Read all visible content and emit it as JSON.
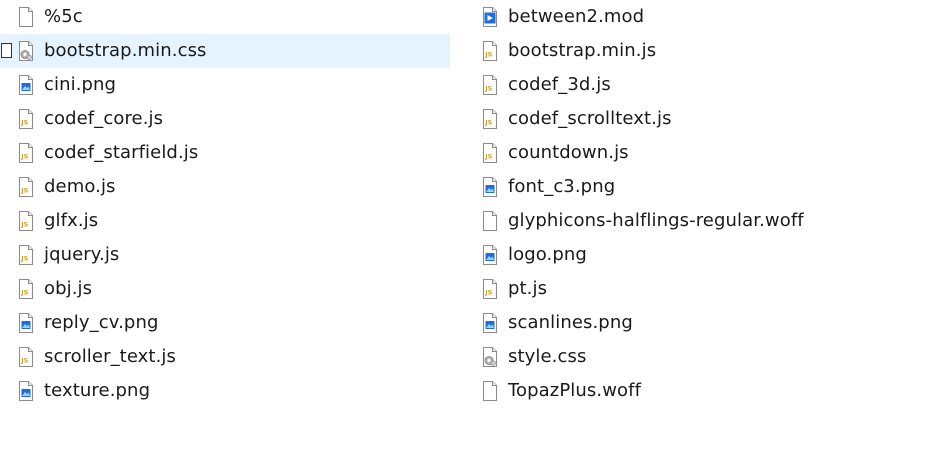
{
  "files_left": [
    {
      "name": "%5c",
      "icon": "generic-file-icon",
      "selected": false
    },
    {
      "name": "bootstrap.min.css",
      "icon": "css-file-icon",
      "selected": true
    },
    {
      "name": "cini.png",
      "icon": "image-file-icon",
      "selected": false
    },
    {
      "name": "codef_core.js",
      "icon": "js-file-icon",
      "selected": false
    },
    {
      "name": "codef_starfield.js",
      "icon": "js-file-icon",
      "selected": false
    },
    {
      "name": "demo.js",
      "icon": "js-file-icon",
      "selected": false
    },
    {
      "name": "glfx.js",
      "icon": "js-file-icon",
      "selected": false
    },
    {
      "name": "jquery.js",
      "icon": "js-file-icon",
      "selected": false
    },
    {
      "name": "obj.js",
      "icon": "js-file-icon",
      "selected": false
    },
    {
      "name": "reply_cv.png",
      "icon": "image-file-icon",
      "selected": false
    },
    {
      "name": "scroller_text.js",
      "icon": "js-file-icon",
      "selected": false
    },
    {
      "name": "texture.png",
      "icon": "image-file-icon",
      "selected": false
    }
  ],
  "files_right": [
    {
      "name": "between2.mod",
      "icon": "media-file-icon",
      "selected": false
    },
    {
      "name": "bootstrap.min.js",
      "icon": "js-file-icon",
      "selected": false
    },
    {
      "name": "codef_3d.js",
      "icon": "js-file-icon",
      "selected": false
    },
    {
      "name": "codef_scrolltext.js",
      "icon": "js-file-icon",
      "selected": false
    },
    {
      "name": "countdown.js",
      "icon": "js-file-icon",
      "selected": false
    },
    {
      "name": "font_c3.png",
      "icon": "image-file-icon",
      "selected": false
    },
    {
      "name": "glyphicons-halflings-regular.woff",
      "icon": "generic-file-icon",
      "selected": false
    },
    {
      "name": "logo.png",
      "icon": "image-file-icon",
      "selected": false
    },
    {
      "name": "pt.js",
      "icon": "js-file-icon",
      "selected": false
    },
    {
      "name": "scanlines.png",
      "icon": "image-file-icon",
      "selected": false
    },
    {
      "name": "style.css",
      "icon": "css-file-icon",
      "selected": false
    },
    {
      "name": "TopazPlus.woff",
      "icon": "generic-file-icon",
      "selected": false
    }
  ],
  "colors": {
    "selection": "#e5f3ff",
    "text": "#1a1a1a",
    "js_badge": "#c9a227",
    "image_badge": "#1e6fd9"
  }
}
